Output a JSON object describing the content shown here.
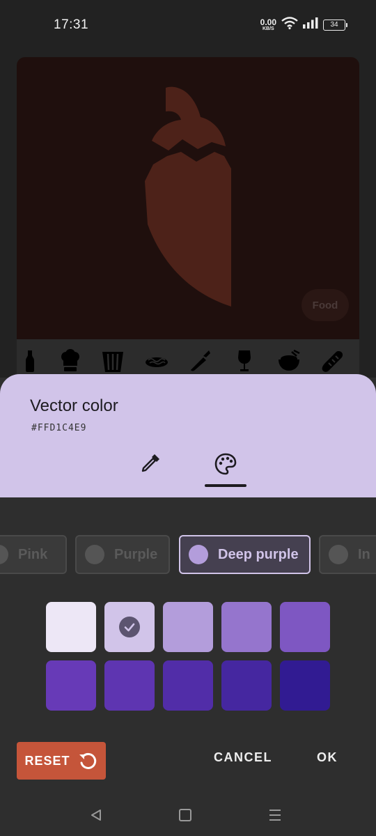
{
  "status_bar": {
    "time": "17:31",
    "net_speed": "0.00",
    "net_unit": "KB/S",
    "battery": "34"
  },
  "preview": {
    "category_chip": "Food",
    "icon_strip": [
      "bottle-icon",
      "chef-hat-icon",
      "popcorn-icon",
      "noodles-icon",
      "chili-icon",
      "wine-glass-icon",
      "rice-bowl-icon",
      "baguette-icon"
    ],
    "vector_color": "#4d2219",
    "background_color": "#1f0f0d"
  },
  "sheet": {
    "title": "Vector color",
    "hex_value": "#FFD1C4E9",
    "tabs": [
      "eyedropper-icon",
      "palette-icon"
    ],
    "active_tab": "palette-icon",
    "color_families": [
      "Pink",
      "Purple",
      "Deep purple",
      "In"
    ],
    "selected_family": "Deep purple",
    "swatches": [
      "#ede7f6",
      "#d1c4e9",
      "#b39ddb",
      "#9575cd",
      "#7e57c2",
      "#673ab7",
      "#5e35b1",
      "#512da8",
      "#4527a0",
      "#311b92"
    ],
    "selected_swatch": "#d1c4e9",
    "reset_label": "RESET",
    "cancel_label": "CANCEL",
    "ok_label": "OK",
    "reset_color": "#c5553a"
  },
  "nav_bar": [
    "back-icon",
    "home-icon",
    "menu-icon"
  ]
}
